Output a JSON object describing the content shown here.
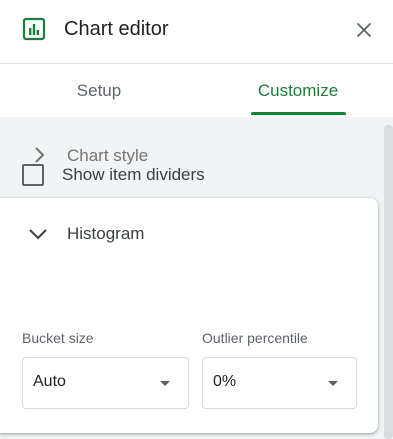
{
  "header": {
    "title": "Chart editor",
    "icon": "bar-chart-icon",
    "close_icon": "close-icon"
  },
  "tabs": [
    {
      "label": "Setup",
      "active": false
    },
    {
      "label": "Customize",
      "active": true
    }
  ],
  "sections": {
    "chart_style": {
      "label": "Chart style",
      "expanded": false
    },
    "histogram": {
      "label": "Histogram",
      "expanded": true,
      "show_item_dividers": {
        "label": "Show item dividers",
        "checked": false
      },
      "bucket_size": {
        "label": "Bucket size",
        "value": "Auto"
      },
      "outlier_percentile": {
        "label": "Outlier percentile",
        "value": "0%"
      }
    }
  },
  "colors": {
    "accent": "#188038",
    "text_secondary": "#5f6368",
    "background": "#f1f3f4"
  }
}
